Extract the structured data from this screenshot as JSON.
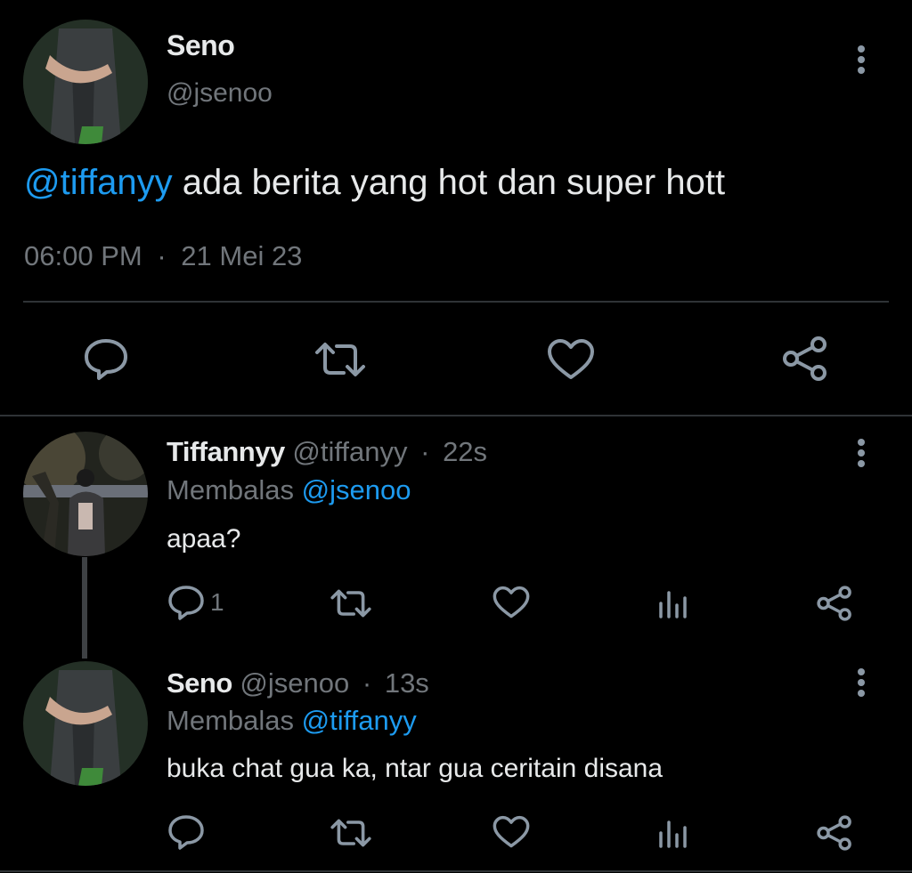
{
  "main_tweet": {
    "author_name": "Seno",
    "author_handle": "@jsenoo",
    "mention": "@tiffanyy",
    "text": " ada berita yang hot dan super hott",
    "time": "06:00 PM",
    "separator": "·",
    "date": "21 Mei 23"
  },
  "replies": [
    {
      "author_name": "Tiffannyy",
      "author_handle": "@tiffanyy",
      "separator": "·",
      "age": "22s",
      "replying_label": "Membalas",
      "replying_to": "@jsenoo",
      "text": "apaa?",
      "reply_count": "1"
    },
    {
      "author_name": "Seno",
      "author_handle": "@jsenoo",
      "separator": "·",
      "age": "13s",
      "replying_label": "Membalas",
      "replying_to": "@tiffanyy",
      "text": "buka chat gua ka, ntar gua ceritain disana",
      "reply_count": ""
    }
  ],
  "icons": {
    "reply": "reply-icon",
    "retweet": "retweet-icon",
    "like": "heart-icon",
    "views": "views-icon",
    "share": "share-icon",
    "more": "more-vertical-icon"
  },
  "colors": {
    "background": "#000000",
    "text": "#e7e9ea",
    "muted": "#71767b",
    "accent": "#1d9bf0",
    "divider": "#2f3336"
  }
}
